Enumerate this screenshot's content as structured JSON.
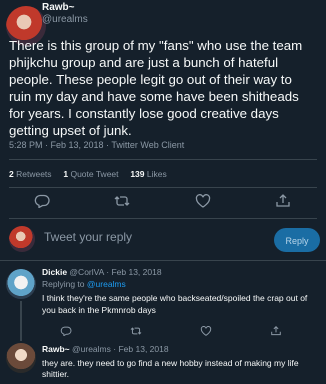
{
  "main_tweet": {
    "display_name": "Rawb~",
    "handle": "@urealms",
    "text": "There is this group of my \"fans\" who use the team phijkchu group and are just a bunch of hateful people. These people legit go out of their way to ruin my day and have some have been shitheads for years. I constantly lose good creative days getting upset of junk.",
    "meta": "5:28 PM · Feb 13, 2018 · Twitter Web Client",
    "stats": {
      "retweets_count": "2",
      "retweets_label": "Retweets",
      "quotes_count": "1",
      "quotes_label": "Quote Tweet",
      "likes_count": "139",
      "likes_label": "Likes"
    }
  },
  "compose": {
    "placeholder": "Tweet your reply",
    "button_label": "Reply"
  },
  "replies": [
    {
      "display_name": "Dickie",
      "handle": "@CorlVA",
      "separator": "·",
      "date": "Feb 13, 2018",
      "replying_to_label": "Replying to",
      "replying_to_handle": "@urealms",
      "text": "I think they're the same people who backseated/spoiled the crap out of you back in the Pkmnrob days"
    },
    {
      "display_name": "Rawb~",
      "handle": "@urealms",
      "separator": "·",
      "date": "Feb 13, 2018",
      "text": "they are. they need to go find a new hobby instead of making my life shittier."
    }
  ],
  "colors": {
    "background": "#15202b",
    "text": "#f7f9f9",
    "muted": "#8b98a5",
    "link": "#1d9bf0",
    "divider": "#38444d"
  },
  "icons": [
    "reply-icon",
    "retweet-icon",
    "like-icon",
    "share-icon"
  ]
}
